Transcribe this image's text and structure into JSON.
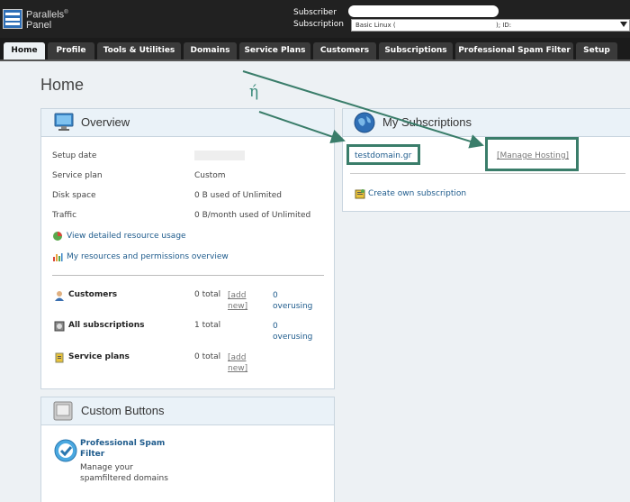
{
  "brand": {
    "line1": "Parallels",
    "line2": "Panel",
    "mark": "®"
  },
  "subscriber": {
    "subscriber_label": "Subscriber",
    "subscription_label": "Subscription",
    "select_value": "Basic Linux (",
    "select_id": "); ID:"
  },
  "tabs": [
    "Home",
    "Profile",
    "Tools & Utilities",
    "Domains",
    "Service Plans",
    "Customers",
    "Subscriptions",
    "Professional Spam Filter",
    "Setup"
  ],
  "page": {
    "title": "Home"
  },
  "annotation": {
    "text": "ή",
    "color": "#3a7d6a"
  },
  "overview": {
    "title": "Overview",
    "rows": [
      {
        "label": "Setup date",
        "value": ""
      },
      {
        "label": "Service plan",
        "value": "Custom"
      },
      {
        "label": "Disk space",
        "value": "0 B used of Unlimited"
      },
      {
        "label": "Traffic",
        "value": "0 B/month used of Unlimited"
      }
    ],
    "link_usage": "View detailed resource usage",
    "link_perms": "My resources and permissions overview",
    "stats": [
      {
        "label": "Customers",
        "total": "0 total",
        "add": "[add new]",
        "over": "0 overusing"
      },
      {
        "label": "All subscriptions",
        "total": "1 total",
        "add": "",
        "over": "0 overusing"
      },
      {
        "label": "Service plans",
        "total": "0 total",
        "add": "[add new]",
        "over": ""
      }
    ]
  },
  "subs": {
    "title": "My Subscriptions",
    "domain": "testdomain.gr",
    "manage": "[Manage Hosting]",
    "create": "Create own subscription"
  },
  "custom": {
    "title": "Custom Buttons",
    "item_title": "Professional Spam Filter",
    "item_desc": "Manage your spamfiltered domains"
  }
}
